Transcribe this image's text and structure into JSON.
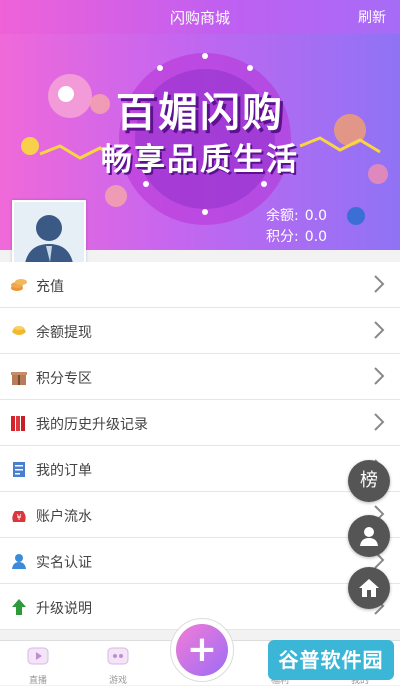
{
  "header": {
    "title": "闪购商城",
    "refresh_label": "刷新"
  },
  "banner": {
    "title_line1": "百媚闪购",
    "title_line2": "畅享品质生活",
    "balance_label": "余额:",
    "balance_value": "0.0",
    "points_label": "积分:",
    "points_value": "0.0"
  },
  "menu": [
    {
      "label": "充值",
      "icon": "coins-icon"
    },
    {
      "label": "余额提现",
      "icon": "gold-ingot-icon"
    },
    {
      "label": "积分专区",
      "icon": "gift-icon"
    },
    {
      "label": "我的历史升级记录",
      "icon": "red-books-icon"
    },
    {
      "label": "我的订单",
      "icon": "orders-icon"
    },
    {
      "label": "账户流水",
      "icon": "yen-bag-icon"
    },
    {
      "label": "实名认证",
      "icon": "person-icon"
    },
    {
      "label": "升级说明",
      "icon": "green-arrow-up-icon"
    }
  ],
  "floating": {
    "rank_label": "榜"
  },
  "bottom_tabs": [
    {
      "label": "直播",
      "icon": "live-icon"
    },
    {
      "label": "游戏",
      "icon": "game-icon"
    },
    {
      "label": "福利",
      "icon": "welfare-icon"
    },
    {
      "label": "我的",
      "icon": "mine-icon"
    }
  ],
  "watermark": "谷普软件园",
  "colors": {
    "brand_pink": "#ef62d8",
    "brand_purple": "#a66cf7"
  }
}
